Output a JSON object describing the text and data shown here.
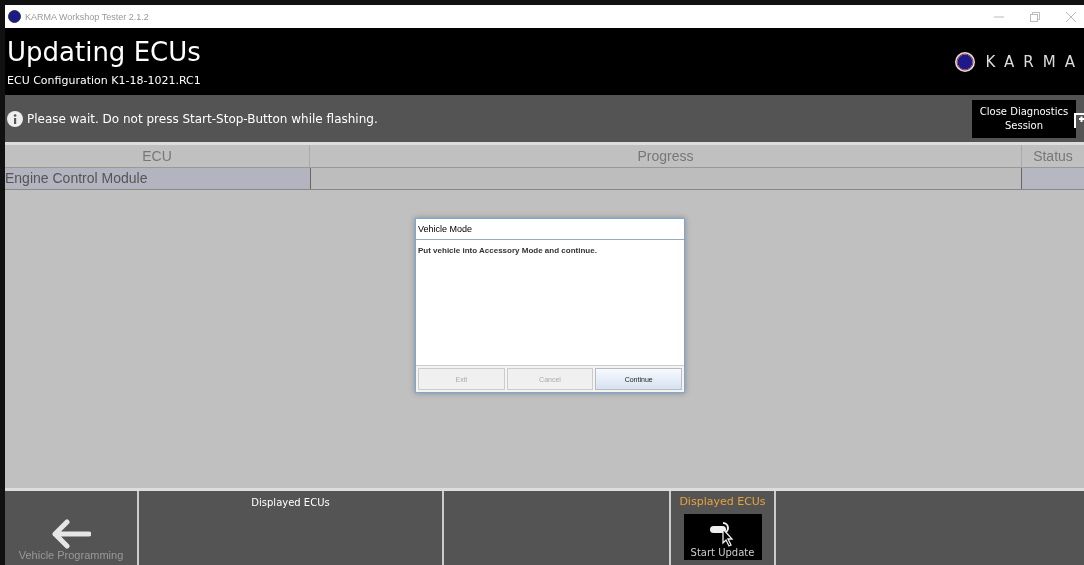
{
  "window": {
    "title": "KARMA Workshop Tester 2.1.2"
  },
  "header": {
    "title": "Updating ECUs",
    "subtitle": "ECU Configuration K1-18-1021.RC1",
    "logo_text": "KARMA"
  },
  "info_bar": {
    "message": "Please wait. Do not press Start-Stop-Button while flashing.",
    "close_button": "Close Diagnostics Session"
  },
  "table": {
    "columns": [
      "ECU",
      "Progress",
      "Status"
    ],
    "rows": [
      {
        "ecu": "Engine Control Module",
        "selected": true
      }
    ]
  },
  "dialog": {
    "title": "Vehicle Mode",
    "message": "Put vehicle into Accessory Mode and continue.",
    "buttons": [
      {
        "label": "Exit",
        "disabled": true
      },
      {
        "label": "Cancel",
        "disabled": true
      },
      {
        "label": "Continue",
        "disabled": false
      }
    ]
  },
  "bottom_bar": {
    "back_button": {
      "label": "Vehicle Programming",
      "disabled": true
    },
    "section_label": "Displayed ECUs",
    "active_section": {
      "label": "Displayed ECUs",
      "button": "Start Update"
    }
  }
}
